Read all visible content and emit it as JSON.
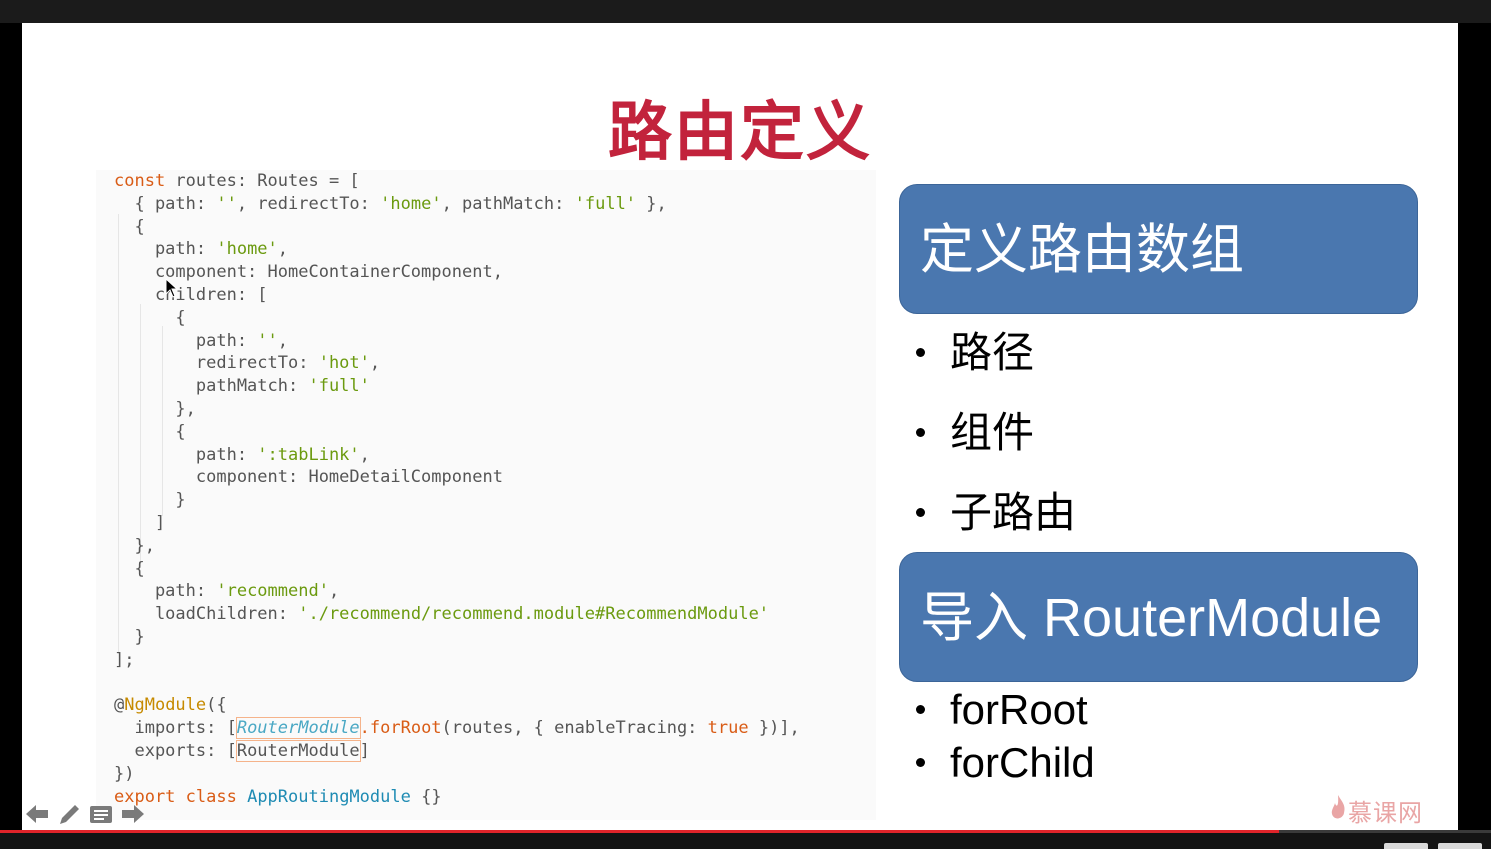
{
  "slide": {
    "title": "路由定义",
    "code_lines": [
      [
        {
          "t": "const",
          "c": "kw"
        },
        {
          "t": " routes: Routes = ["
        }
      ],
      [
        {
          "t": "  { path: "
        },
        {
          "t": "''",
          "c": "str"
        },
        {
          "t": ", redirectTo: "
        },
        {
          "t": "'home'",
          "c": "str"
        },
        {
          "t": ", pathMatch: "
        },
        {
          "t": "'full'",
          "c": "str"
        },
        {
          "t": " },"
        }
      ],
      [
        {
          "t": "  {"
        }
      ],
      [
        {
          "t": "    path: "
        },
        {
          "t": "'home'",
          "c": "str"
        },
        {
          "t": ","
        }
      ],
      [
        {
          "t": "    component: HomeContainerComponent,"
        }
      ],
      [
        {
          "t": "    children: ["
        }
      ],
      [
        {
          "t": "      {"
        }
      ],
      [
        {
          "t": "        path: "
        },
        {
          "t": "''",
          "c": "str"
        },
        {
          "t": ","
        }
      ],
      [
        {
          "t": "        redirectTo: "
        },
        {
          "t": "'hot'",
          "c": "str"
        },
        {
          "t": ","
        }
      ],
      [
        {
          "t": "        pathMatch: "
        },
        {
          "t": "'full'",
          "c": "str"
        }
      ],
      [
        {
          "t": "      },"
        }
      ],
      [
        {
          "t": "      {"
        }
      ],
      [
        {
          "t": "        path: "
        },
        {
          "t": "':tabLink'",
          "c": "str"
        },
        {
          "t": ","
        }
      ],
      [
        {
          "t": "        component: HomeDetailComponent"
        }
      ],
      [
        {
          "t": "      }"
        }
      ],
      [
        {
          "t": "    ]"
        }
      ],
      [
        {
          "t": "  },"
        }
      ],
      [
        {
          "t": "  {"
        }
      ],
      [
        {
          "t": "    path: "
        },
        {
          "t": "'recommend'",
          "c": "str"
        },
        {
          "t": ","
        }
      ],
      [
        {
          "t": "    loadChildren: "
        },
        {
          "t": "'./recommend/recommend.module#RecommendModule'",
          "c": "str"
        }
      ],
      [
        {
          "t": "  }"
        }
      ],
      [
        {
          "t": "];"
        }
      ],
      [
        {
          "t": ""
        }
      ],
      [
        {
          "t": "@",
          "c": ""
        },
        {
          "t": "NgModule",
          "c": "dec"
        },
        {
          "t": "({"
        }
      ],
      [
        {
          "t": "  imports: ["
        },
        {
          "t": "RouterModule",
          "c": "hl-rm"
        },
        {
          "t": ".forRoot",
          "c": "fn"
        },
        {
          "t": "(routes, { enableTracing: "
        },
        {
          "t": "true",
          "c": "kw"
        },
        {
          "t": " })],"
        }
      ],
      [
        {
          "t": "  exports: ["
        },
        {
          "t": "RouterModule",
          "c": "hl-rm2"
        },
        {
          "t": "]"
        }
      ],
      [
        {
          "t": "})"
        }
      ],
      [
        {
          "t": "export class",
          "c": "kw"
        },
        {
          "t": " "
        },
        {
          "t": "AppRoutingModule",
          "c": "ty"
        },
        {
          "t": " {}"
        }
      ]
    ],
    "box1_label": "定义路由数组",
    "box1_items": [
      "路径",
      "组件",
      "子路由"
    ],
    "box2_label": "导入 RouterModule",
    "box2_items": [
      "forRoot",
      "forChild"
    ],
    "brand": "慕课网"
  },
  "player": {
    "progress": 0.858,
    "toolbar_icons": [
      "arrow-left-icon",
      "pen-icon",
      "notes-icon",
      "arrow-right-icon"
    ]
  },
  "colors": {
    "title": "#c2233c",
    "box_fill": "#4a77af",
    "progress": "#e0242a"
  }
}
